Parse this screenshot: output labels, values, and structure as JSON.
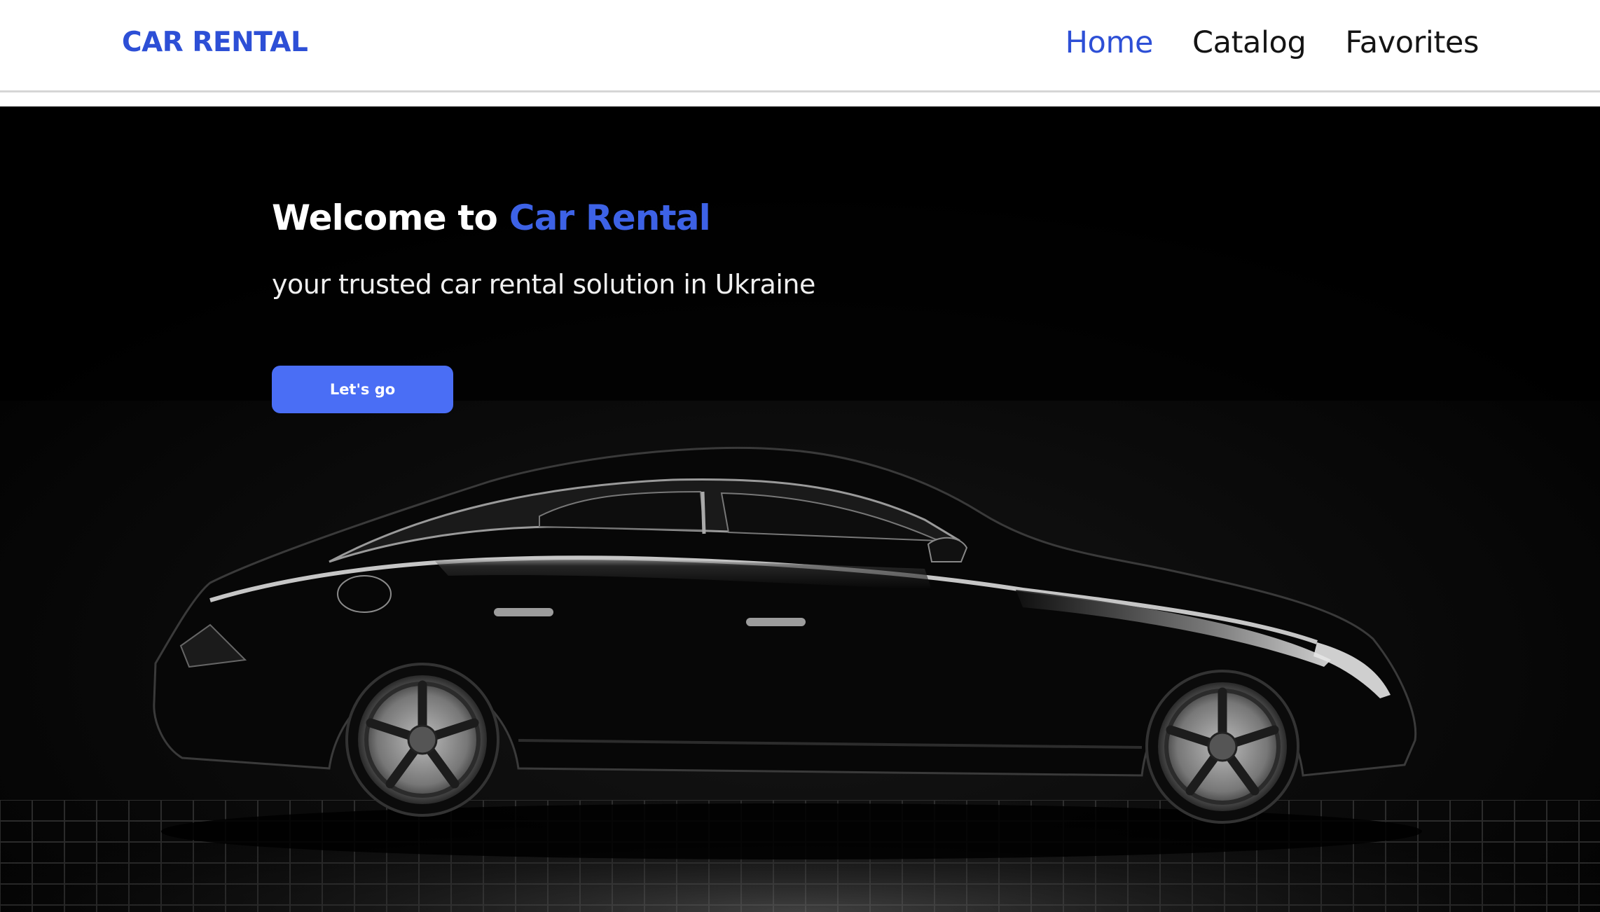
{
  "header": {
    "logo": "CAR RENTAL",
    "nav": [
      {
        "label": "Home",
        "active": true
      },
      {
        "label": "Catalog",
        "active": false
      },
      {
        "label": "Favorites",
        "active": false
      }
    ]
  },
  "hero": {
    "title_prefix": "Welcome to ",
    "title_accent": "Car Rental",
    "subtitle": "your trusted car rental solution in Ukraine",
    "cta_label": "Let's go"
  },
  "colors": {
    "brand": "#2d4fd6",
    "accent_text": "#3d62e6",
    "button": "#4a6ef5",
    "hero_background": "#000000"
  },
  "icons": {
    "hero_image": "black-sedan-car-photo"
  }
}
